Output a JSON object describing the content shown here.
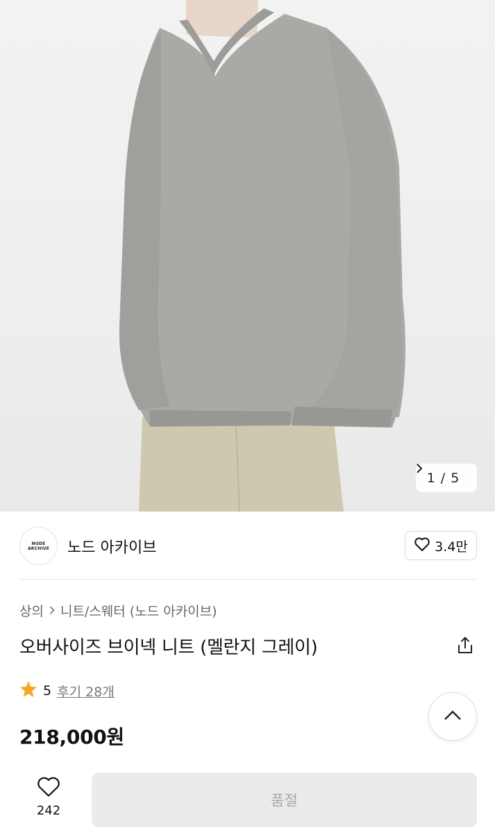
{
  "gallery": {
    "current": "1",
    "separator": "/",
    "total": "5",
    "next_icon": "chevron-right-icon"
  },
  "brand": {
    "logo_text": "NODE ARCHIVE",
    "name": "노드 아카이브",
    "likes": "3.4만",
    "like_icon": "heart-outline-icon"
  },
  "breadcrumb": {
    "items": [
      "상의",
      "니트/스웨터 (노드 아카이브)"
    ],
    "separator_icon": "chevron-right-icon"
  },
  "product": {
    "title": "오버사이즈 브이넥 니트 (멜란지 그레이)",
    "rating": "5",
    "reviews": "후기 28개",
    "price": "218,000원",
    "star_color": "#F5A623"
  },
  "bottom_bar": {
    "wish_count": "242",
    "action_label": "품절"
  }
}
